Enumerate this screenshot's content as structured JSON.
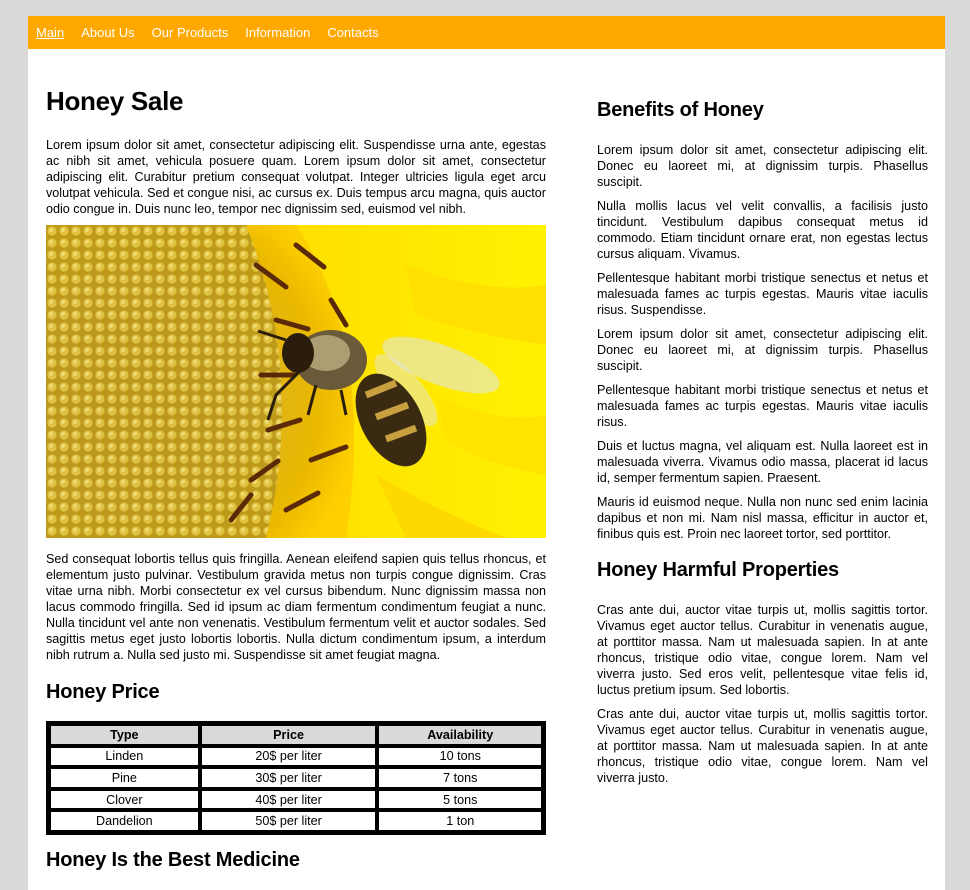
{
  "nav": {
    "items": [
      "Main",
      "About Us",
      "Our Products",
      "Information",
      "Contacts"
    ]
  },
  "left": {
    "title": "Honey Sale",
    "intro": "Lorem ipsum dolor sit amet, consectetur adipiscing elit. Suspendisse urna ante, egestas ac nibh sit amet, vehicula posuere quam. Lorem ipsum dolor sit amet, consectetur adipiscing elit. Curabitur pretium consequat volutpat. Integer ultricies ligula eget arcu volutpat vehicula. Sed et congue nisi, ac cursus ex. Duis tempus arcu magna, quis auctor odio congue in. Duis nunc leo, tempor nec dignissim sed, euismod vel nibh.",
    "image_alt": "bee-on-sunflower",
    "after_image": "Sed consequat lobortis tellus quis fringilla. Aenean eleifend sapien quis tellus rhoncus, et elementum justo pulvinar. Vestibulum gravida metus non turpis congue dignissim. Cras vitae urna nibh. Morbi consectetur ex vel cursus bibendum. Nunc dignissim massa non lacus commodo fringilla. Sed id ipsum ac diam fermentum condimentum feugiat a nunc. Nulla tincidunt vel ante non venenatis. Vestibulum fermentum velit et auctor sodales. Sed sagittis metus eget justo lobortis lobortis. Nulla dictum condimentum ipsum, a interdum nibh rutrum a. Nulla sed justo mi. Suspendisse sit amet feugiat magna.",
    "price_heading": "Honey Price",
    "table": {
      "headers": [
        "Type",
        "Price",
        "Availability"
      ],
      "rows": [
        [
          "Linden",
          "20$ per liter",
          "10 tons"
        ],
        [
          "Pine",
          "30$ per liter",
          "7 tons"
        ],
        [
          "Clover",
          "40$ per liter",
          "5 tons"
        ],
        [
          "Dandelion",
          "50$ per liter",
          "1 ton"
        ]
      ]
    },
    "medicine_heading": "Honey Is the Best Medicine"
  },
  "right": {
    "benefits_heading": "Benefits of Honey",
    "benefits": [
      "Lorem ipsum dolor sit amet, consectetur adipiscing elit. Donec eu laoreet mi, at dignissim turpis. Phasellus suscipit.",
      "Nulla mollis lacus vel velit convallis, a facilisis justo tincidunt. Vestibulum dapibus consequat metus id commodo. Etiam tincidunt ornare erat, non egestas lectus cursus aliquam. Vivamus.",
      "Pellentesque habitant morbi tristique senectus et netus et malesuada fames ac turpis egestas. Mauris vitae iaculis risus. Suspendisse.",
      "Lorem ipsum dolor sit amet, consectetur adipiscing elit. Donec eu laoreet mi, at dignissim turpis. Phasellus suscipit.",
      "Pellentesque habitant morbi tristique senectus et netus et malesuada fames ac turpis egestas. Mauris vitae iaculis risus.",
      "Duis et luctus magna, vel aliquam est. Nulla laoreet est in malesuada viverra. Vivamus odio massa, placerat id lacus id, semper fermentum sapien. Praesent.",
      "Mauris id euismod neque. Nulla non nunc sed enim lacinia dapibus et non mi. Nam nisl massa, efficitur in auctor et, finibus quis est. Proin nec laoreet tortor, sed porttitor."
    ],
    "harmful_heading": "Honey Harmful Properties",
    "harmful": [
      "Cras ante dui, auctor vitae turpis ut, mollis sagittis tortor. Vivamus eget auctor tellus. Curabitur in venenatis augue, at porttitor massa. Nam ut malesuada sapien. In at ante rhoncus, tristique odio vitae, congue lorem. Nam vel viverra justo. Sed eros velit, pellentesque vitae felis id, luctus pretium ipsum. Sed lobortis.",
      "Cras ante dui, auctor vitae turpis ut, mollis sagittis tortor. Vivamus eget auctor tellus. Curabitur in venenatis augue, at porttitor massa. Nam ut malesuada sapien. In at ante rhoncus, tristique odio vitae, congue lorem. Nam vel viverra justo."
    ]
  },
  "colors": {
    "nav_bg": "#ffa800",
    "page_bg": "#d9d9d9",
    "table_header_bg": "#d9d9d9"
  }
}
